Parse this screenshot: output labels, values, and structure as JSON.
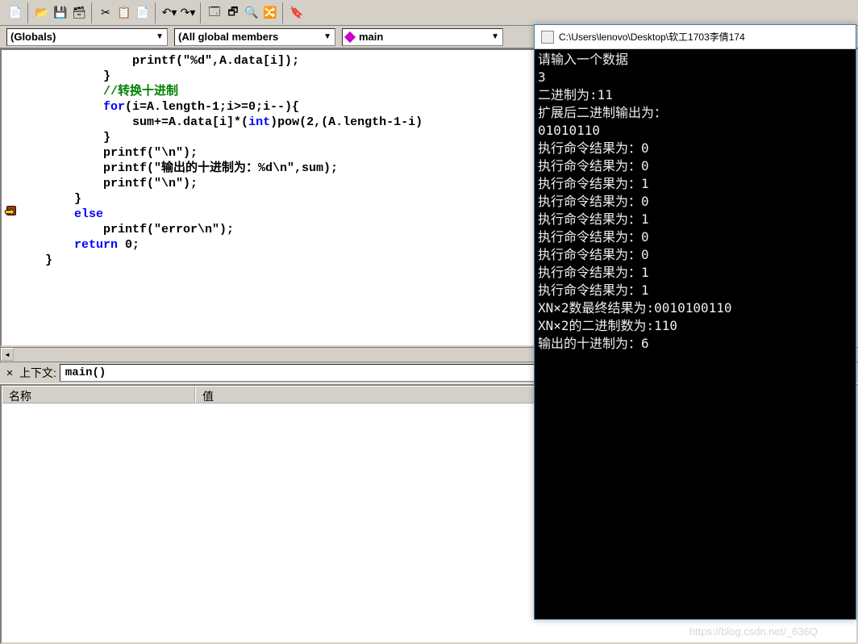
{
  "toolbar": {
    "icons": [
      "new-text",
      "open",
      "save",
      "save-all",
      "cut",
      "copy",
      "paste",
      "undo",
      "redo",
      "window1",
      "window2",
      "find",
      "toggle"
    ]
  },
  "dropdowns": {
    "scope": "(Globals)",
    "members": "(All global members",
    "function": "main"
  },
  "code": {
    "lines": [
      {
        "indent": 14,
        "segs": [
          {
            "t": "printf(\"%d\",A.data[i]);"
          }
        ]
      },
      {
        "indent": 10,
        "segs": [
          {
            "t": "}"
          }
        ]
      },
      {
        "indent": 10,
        "segs": [
          {
            "t": "//转换十进制",
            "cls": "comment"
          }
        ]
      },
      {
        "indent": 10,
        "segs": [
          {
            "t": "for",
            "cls": "kw"
          },
          {
            "t": "(i=A.length-1;i>=0;i--){"
          }
        ]
      },
      {
        "indent": 14,
        "segs": [
          {
            "t": "sum+=A.data[i]*("
          },
          {
            "t": "int",
            "cls": "kw"
          },
          {
            "t": ")pow(2,(A.length-1-i)"
          }
        ]
      },
      {
        "indent": 10,
        "segs": [
          {
            "t": "}"
          }
        ]
      },
      {
        "indent": 10,
        "segs": [
          {
            "t": "printf(\"\\n\");"
          }
        ]
      },
      {
        "indent": 10,
        "segs": [
          {
            "t": "printf(\"输出的十进制为：%d\\n\",sum);"
          }
        ]
      },
      {
        "indent": 10,
        "segs": [
          {
            "t": "printf(\"\\n\");"
          }
        ]
      },
      {
        "indent": 6,
        "segs": [
          {
            "t": "}"
          }
        ]
      },
      {
        "indent": 6,
        "segs": [
          {
            "t": "else",
            "cls": "kw"
          }
        ],
        "marker": "arrow"
      },
      {
        "indent": 10,
        "segs": [
          {
            "t": "printf(\"error\\n\");"
          }
        ]
      },
      {
        "indent": 6,
        "segs": [
          {
            "t": "return",
            "cls": "kw"
          },
          {
            "t": " 0;"
          }
        ]
      },
      {
        "indent": 2,
        "segs": [
          {
            "t": "}"
          }
        ]
      }
    ]
  },
  "context": {
    "label": "上下文:",
    "value": "main()"
  },
  "watch": {
    "col1": "名称",
    "col2": "值"
  },
  "console": {
    "title": "C:\\Users\\lenovo\\Desktop\\软工1703李倩174",
    "lines": [
      "请输入一个数据",
      "3",
      "二进制为:11",
      "扩展后二进制输出为：",
      "01010110",
      "执行命令结果为：0",
      "执行命令结果为：0",
      "执行命令结果为：1",
      "执行命令结果为：0",
      "执行命令结果为：1",
      "执行命令结果为：0",
      "执行命令结果为：0",
      "执行命令结果为：1",
      "执行命令结果为：1",
      "XN×2数最终结果为:0010100110",
      "XN×2的二进制数为:110",
      "输出的十进制为：6"
    ]
  },
  "watermark": "https://blog.csdn.net/_636Q"
}
